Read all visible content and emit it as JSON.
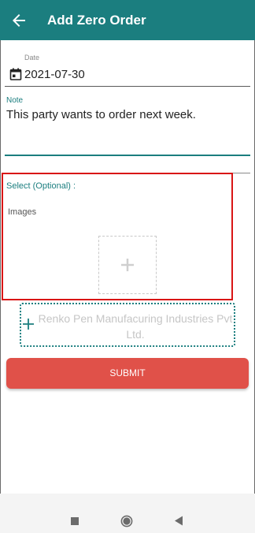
{
  "header": {
    "title": "Add Zero Order",
    "back_icon": "arrow-left-icon"
  },
  "date": {
    "label": "Date",
    "value": "2021-07-30",
    "icon": "calendar-icon"
  },
  "note": {
    "label": "Note",
    "value": "This party wants to order next week."
  },
  "select": {
    "label": "Select (Optional) :"
  },
  "images": {
    "label": "Images",
    "add_icon": "plus-icon"
  },
  "party": {
    "name": "Renko Pen Manufacuring Industries Pvt Ltd.",
    "icon": "plus-icon"
  },
  "submit": {
    "label": "SUBMIT"
  },
  "colors": {
    "primary": "#1b7e7f",
    "submit": "#e05149",
    "highlight": "#d91515"
  },
  "navbar": {
    "icons": [
      "recents-square-icon",
      "home-circle-icon",
      "back-triangle-icon"
    ]
  }
}
